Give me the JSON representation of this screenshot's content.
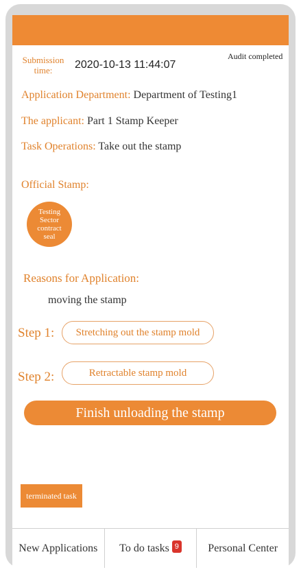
{
  "status": {
    "audit": "Audit completed"
  },
  "submission": {
    "label": "Submission time:",
    "value": "2020-10-13 11:44:07"
  },
  "fields": {
    "department": {
      "label": "Application Department:",
      "value": "Department of Testing1"
    },
    "applicant": {
      "label": "The applicant:",
      "value": "Part 1 Stamp Keeper"
    },
    "task": {
      "label": "Task Operations:",
      "value": "Take out the stamp"
    }
  },
  "stamp": {
    "label": "Official Stamp:",
    "name": "Testing Sector contract seal"
  },
  "reasons": {
    "label": "Reasons for Application:",
    "value": "moving the stamp"
  },
  "steps": [
    {
      "label": "Step 1:",
      "button": "Stretching out the stamp mold"
    },
    {
      "label": "Step 2:",
      "button": "Retractable stamp mold"
    }
  ],
  "actions": {
    "finish": "Finish unloading the stamp",
    "terminated": "terminated task"
  },
  "tabs": [
    {
      "label": "New Applications"
    },
    {
      "label": "To do tasks",
      "badge": "9"
    },
    {
      "label": "Personal Center"
    }
  ],
  "colors": {
    "accent": "#ec8a35",
    "badge": "#d9342b"
  }
}
